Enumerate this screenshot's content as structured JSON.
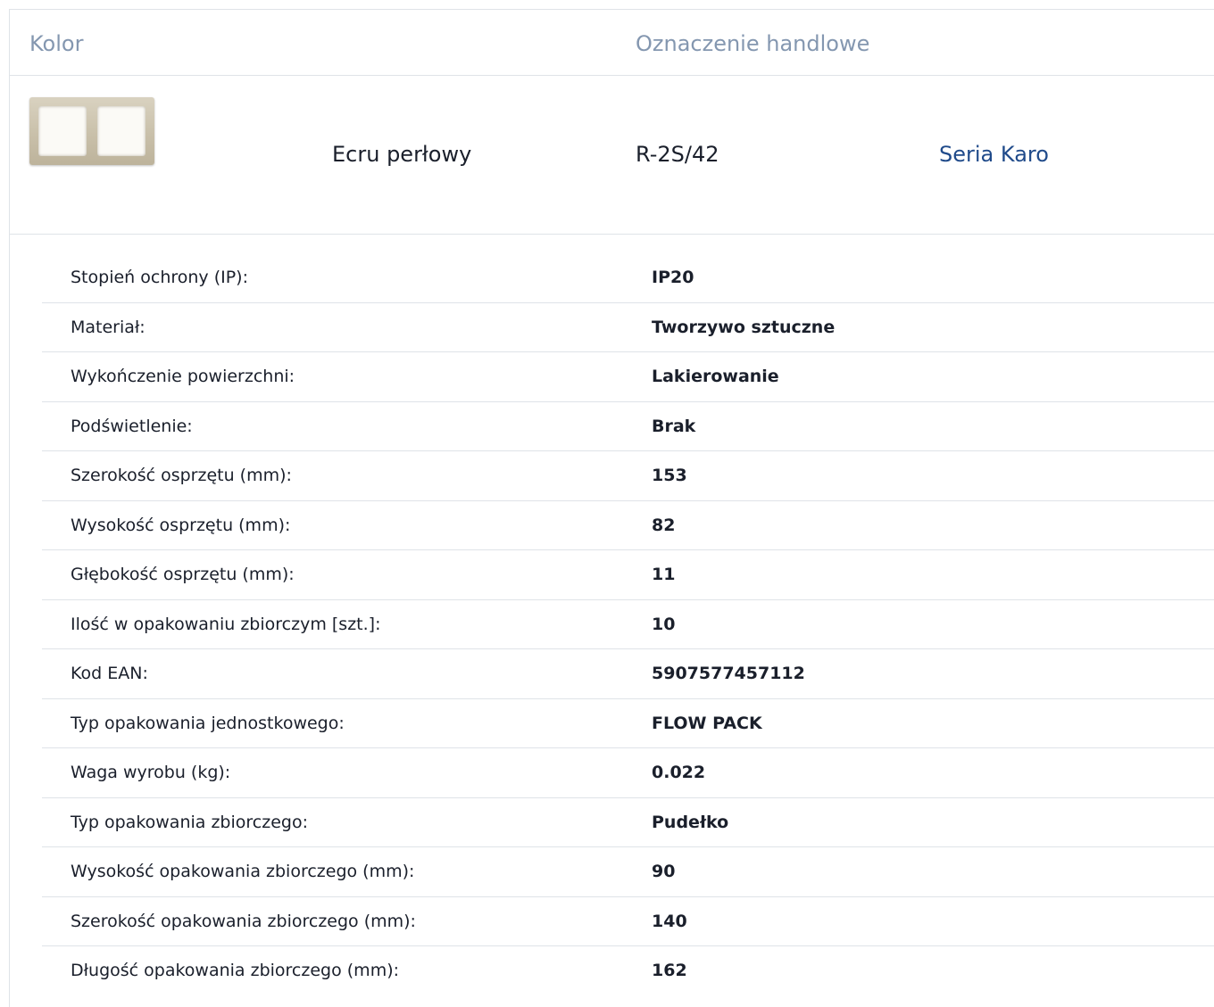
{
  "header": {
    "color_label": "Kolor",
    "trade_label": "Oznaczenie handlowe"
  },
  "product": {
    "color_name": "Ecru perłowy",
    "code": "R-2S/42",
    "series_link": "Seria Karo",
    "series_link_color": "#1f4a8a"
  },
  "specs": [
    {
      "label": "Stopień ochrony (IP):",
      "value": "IP20"
    },
    {
      "label": "Materiał:",
      "value": "Tworzywo sztuczne"
    },
    {
      "label": "Wykończenie powierzchni:",
      "value": "Lakierowanie"
    },
    {
      "label": "Podświetlenie:",
      "value": "Brak"
    },
    {
      "label": "Szerokość osprzętu (mm):",
      "value": "153"
    },
    {
      "label": "Wysokość osprzętu (mm):",
      "value": "82"
    },
    {
      "label": "Głębokość osprzętu (mm):",
      "value": "11"
    },
    {
      "label": "Ilość w opakowaniu zbiorczym [szt.]:",
      "value": "10"
    },
    {
      "label": "Kod EAN:",
      "value": "5907577457112"
    },
    {
      "label": "Typ opakowania jednostkowego:",
      "value": "FLOW PACK"
    },
    {
      "label": "Waga wyrobu (kg):",
      "value": "0.022"
    },
    {
      "label": "Typ opakowania zbiorczego:",
      "value": "Pudełko"
    },
    {
      "label": "Wysokość opakowania zbiorczego (mm):",
      "value": "90"
    },
    {
      "label": "Szerokość opakowania zbiorczego (mm):",
      "value": "140"
    },
    {
      "label": "Długość opakowania zbiorczego (mm):",
      "value": "162"
    }
  ]
}
